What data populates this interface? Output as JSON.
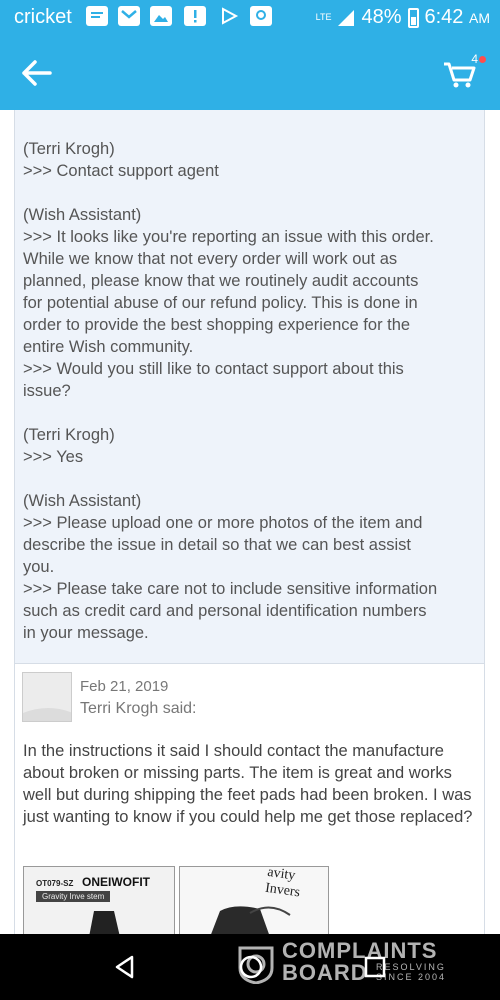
{
  "status_bar": {
    "carrier": "cricket",
    "network": "LTE",
    "battery": "48%",
    "time": "6:42",
    "ampm": "AM",
    "icons": [
      "message-icon",
      "mail-icon",
      "image-icon",
      "alert-icon",
      "play-store-icon",
      "maps-icon",
      "signal-icon",
      "battery-icon"
    ]
  },
  "app_bar": {
    "back_icon": "arrow-left-icon",
    "cart_icon": "cart-icon",
    "cart_count": "4"
  },
  "chat": {
    "lines": [
      "(Terri Krogh)",
      ">>> Contact support agent",
      "",
      "(Wish Assistant)",
      ">>> It looks like you're reporting an issue with this order.",
      "While we know that not every order will work out as",
      "planned, please know that we routinely audit accounts",
      "for potential abuse of our refund policy. This is done in",
      "order to provide the best shopping experience for the",
      "entire Wish community.",
      ">>> Would you still like to contact support about this",
      "issue?",
      "",
      "(Terri Krogh)",
      ">>> Yes",
      "",
      "(Wish Assistant)",
      ">>> Please upload one or more photos of the item and",
      "describe the issue in detail so that we can best assist",
      "you.",
      ">>> Please take care not to include sensitive information",
      "such as credit card and personal identification numbers",
      "in your message."
    ]
  },
  "comment": {
    "date": "Feb 21, 2019",
    "author": "Terri Krogh said:",
    "body": "In the instructions it said I should contact the manufacture about broken or missing parts. The item is great and works well but during shipping the feet pads had been broken. I was just wanting to know if you could help me get those replaced?",
    "thumb1": {
      "code": "OT079-SZ",
      "brand": "ONEIWOFIT",
      "subtitle": "Gravity Inve     stem"
    },
    "thumb2": {
      "text": "avity Invers"
    }
  },
  "watermark": {
    "line1": "COMPLAINTS",
    "line2": "BOARD",
    "line3": "RESOLVING",
    "line4": "SINCE 2004"
  },
  "colors": {
    "accent": "#2fb0e6",
    "chat_bg": "#eef3fa",
    "cart_badge": "#ff4d4d"
  }
}
